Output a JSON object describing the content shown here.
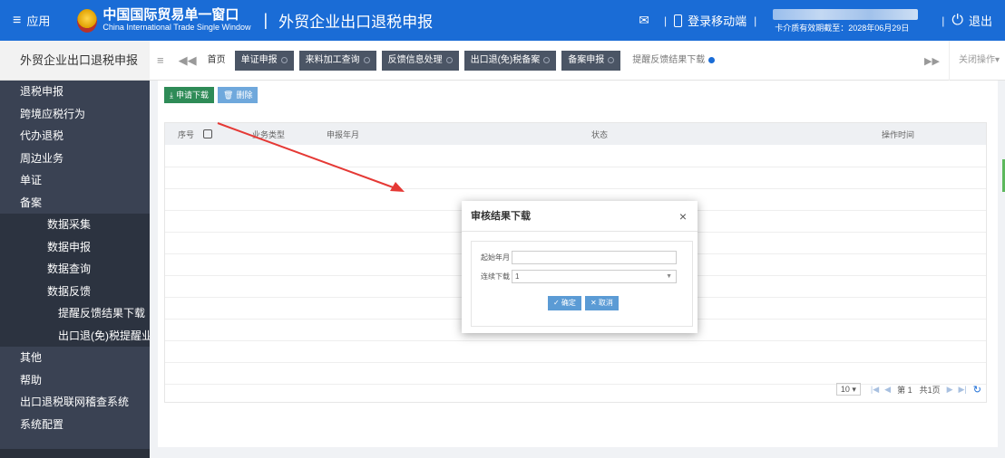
{
  "topbar": {
    "menu_icon": "≡",
    "menu_label": "应用",
    "logo_cn": "中国国际贸易单一窗口",
    "logo_en": "China International Trade Single Window",
    "system_title": "外贸企业出口退税申报",
    "mail_icon": "✉",
    "mobile_label": "登录移动端",
    "card_expiry": "卡介质有效期截至：2028年06月29日",
    "logout_label": "退出",
    "power_icon": "⏻",
    "brand_color": "#1a6cd6"
  },
  "sidebar": {
    "title": "外贸企业出口退税申报",
    "items": [
      {
        "label": "退税申报"
      },
      {
        "label": "跨境应税行为"
      },
      {
        "label": "代办退税"
      },
      {
        "label": "周边业务"
      },
      {
        "label": "单证"
      },
      {
        "label": "备案"
      }
    ],
    "sub_items": [
      {
        "label": "数据采集"
      },
      {
        "label": "数据申报"
      },
      {
        "label": "数据查询"
      },
      {
        "label": "数据反馈"
      }
    ],
    "sub_sub_items": [
      {
        "label": "提醒反馈结果下载"
      },
      {
        "label": "出口退(免)税提醒业务查"
      }
    ],
    "bottom_items": [
      {
        "label": "其他"
      },
      {
        "label": "帮助"
      },
      {
        "label": "出口退税联网稽查系统"
      },
      {
        "label": "系统配置"
      }
    ]
  },
  "tabs": {
    "menu_toggle": "≡",
    "back": "◀◀",
    "items": [
      {
        "label": "首页"
      },
      {
        "label": "单证申报"
      },
      {
        "label": "来料加工查询"
      },
      {
        "label": "反馈信息处理"
      },
      {
        "label": "出口退(免)税备案"
      },
      {
        "label": "备案申报"
      },
      {
        "label": "提醒反馈结果下载"
      }
    ],
    "forward": "▶▶",
    "close_ops": "关闭操作▾"
  },
  "toolbar": {
    "apply_download": "申请下载",
    "delete": "删除"
  },
  "grid": {
    "columns": [
      "序号",
      "业务类型",
      "申报年月",
      "状态",
      "操作时间"
    ]
  },
  "pager": {
    "page_size": "10",
    "page_label": "第 1",
    "total_label": "共1页"
  },
  "modal": {
    "title": "审核结果下载",
    "close": "×",
    "start_label": "起始年月",
    "start_value": "",
    "count_label": "连续下载",
    "count_value": "1",
    "confirm": "✓ 确定",
    "cancel": "✕ 取消"
  }
}
